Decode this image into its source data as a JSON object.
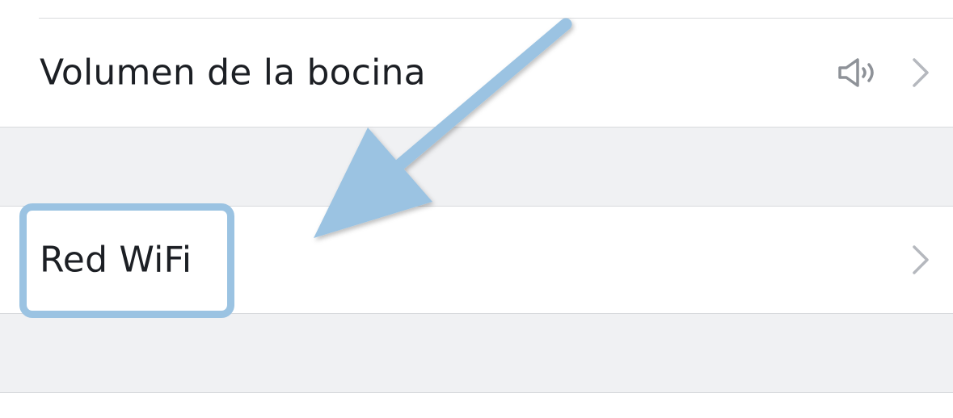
{
  "settings": {
    "volume_row": {
      "label": "Volumen de la bocina",
      "icon": "speaker-volume-icon"
    },
    "wifi_row": {
      "label": "Red WiFi"
    }
  },
  "annotation": {
    "highlight_color": "#9bc3e2",
    "arrow_color": "#9bc3e2"
  },
  "colors": {
    "divider": "#d8dadd",
    "group_background": "#f0f1f3",
    "chevron": "#b5b8be",
    "icon": "#8e9298",
    "text": "#1c1f24"
  }
}
